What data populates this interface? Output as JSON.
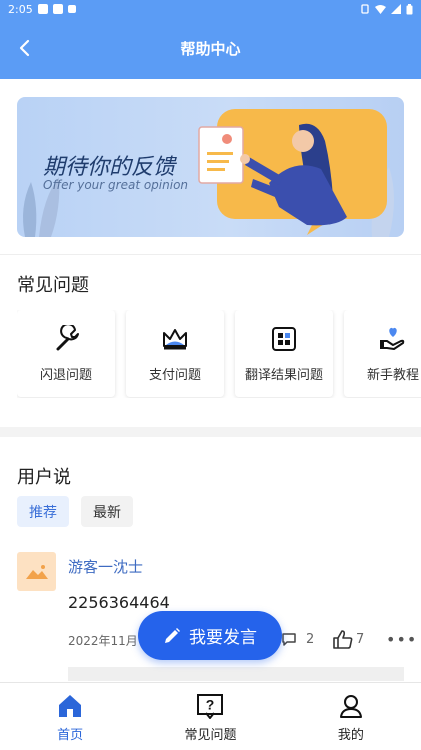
{
  "status_bar": {
    "time": "2:05"
  },
  "header": {
    "title": "帮助中心"
  },
  "banner": {
    "headline": "期待你的反馈",
    "subtitle": "Offer your great opinion"
  },
  "faq": {
    "title": "常见问题",
    "items": [
      {
        "label": "闪退问题",
        "icon": "wrench-icon"
      },
      {
        "label": "支付问题",
        "icon": "crown-icon"
      },
      {
        "label": "翻译结果问题",
        "icon": "grid-icon"
      },
      {
        "label": "新手教程",
        "icon": "heart-hand-icon"
      }
    ]
  },
  "user_say": {
    "title": "用户说",
    "tabs": [
      {
        "label": "推荐",
        "active": true
      },
      {
        "label": "最新",
        "active": false
      }
    ]
  },
  "post": {
    "username": "游客一沈士",
    "content": "2256364464",
    "date": "2022年11月",
    "comments": "2",
    "likes": "7"
  },
  "fab": {
    "label": "我要发言"
  },
  "bottom_nav": [
    {
      "label": "首页",
      "active": true
    },
    {
      "label": "常见问题",
      "active": false
    },
    {
      "label": "我的",
      "active": false
    }
  ],
  "colors": {
    "accent": "#2563eb",
    "header": "#5b9cf5"
  }
}
